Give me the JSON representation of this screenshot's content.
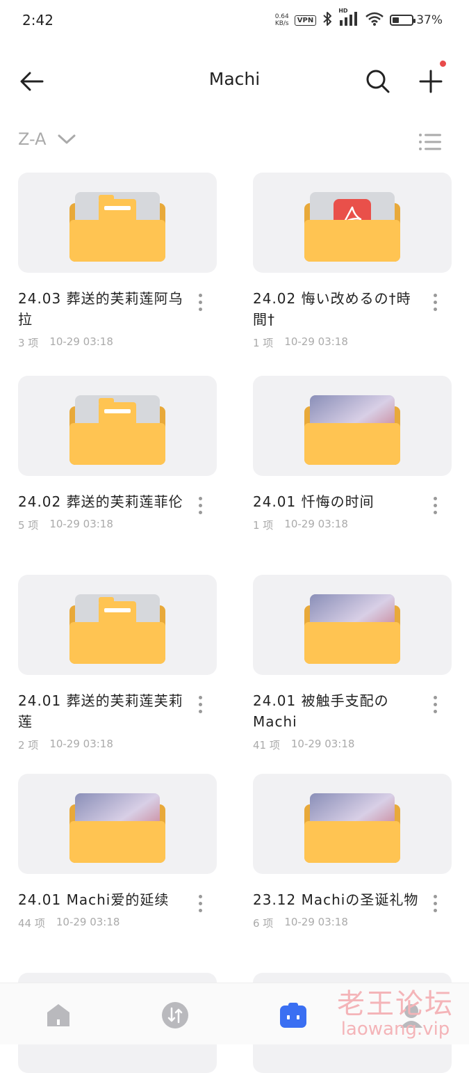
{
  "status_bar": {
    "time": "2:42",
    "net_speed_value": "0.64",
    "net_speed_unit": "KB/s",
    "vpn_label": "VPN",
    "signal_label": "HD",
    "battery_percent": "37%",
    "battery_level": 0.37
  },
  "header": {
    "title": "Machi",
    "back_icon": "arrow-left-icon",
    "search_icon": "search-icon",
    "add_icon": "plus-icon",
    "notification_dot_color": "#e84a4a"
  },
  "sort": {
    "label": "Z-A",
    "view_icon": "list-view-icon"
  },
  "folders": [
    {
      "title": "24.03 葬送的芙莉莲阿乌拉",
      "count": "3 项",
      "date": "10-29 03:18",
      "thumb": "folder"
    },
    {
      "title": "24.02 悔い改めるの†時間†",
      "count": "1 项",
      "date": "10-29 03:18",
      "thumb": "pdf"
    },
    {
      "title": "24.02 葬送的芙莉莲菲伦",
      "count": "5 项",
      "date": "10-29 03:18",
      "thumb": "folder"
    },
    {
      "title": "24.01 忏悔の时间",
      "count": "1 项",
      "date": "10-29 03:18",
      "thumb": "image"
    },
    {
      "title": "24.01 葬送的芙莉莲芙莉莲",
      "count": "2 项",
      "date": "10-29 03:18",
      "thumb": "folder"
    },
    {
      "title": "24.01 被触手支配のMachi",
      "count": "41 项",
      "date": "10-29 03:18",
      "thumb": "image"
    },
    {
      "title": "24.01 Machi爱的延续",
      "count": "44 项",
      "date": "10-29 03:18",
      "thumb": "image"
    },
    {
      "title": "23.12 Machiの圣诞礼物",
      "count": "6 项",
      "date": "10-29 03:18",
      "thumb": "image"
    }
  ],
  "bottom_nav": {
    "home_icon": "home-icon",
    "transfer_icon": "transfer-icon",
    "files_icon": "files-icon",
    "profile_icon": "profile-icon",
    "active_color": "#3a6ff2"
  },
  "watermark": {
    "line1": "老王论坛",
    "line2": "laowang.vip"
  },
  "colors": {
    "folder_front": "#ffc452",
    "folder_back": "#e8a93a",
    "card_bg": "#f1f1f3",
    "pdf_red": "#e9504a"
  }
}
